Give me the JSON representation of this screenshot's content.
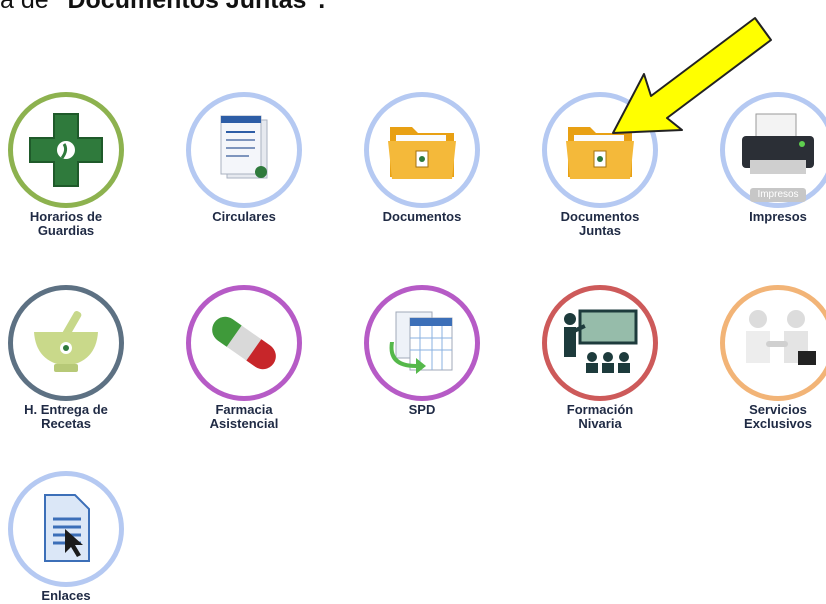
{
  "heading": {
    "prefix": "a de ",
    "bold": "\"Documentos Juntas\"."
  },
  "tiles": [
    {
      "line1": "Horarios de",
      "line2": "Guardias",
      "icon": "pharmacy-cross-icon"
    },
    {
      "line1": "Circulares",
      "line2": "",
      "icon": "document-stack-icon"
    },
    {
      "line1": "Documentos",
      "line2": "",
      "icon": "folder-icon"
    },
    {
      "line1": "Documentos",
      "line2": "Juntas",
      "icon": "folder-icon"
    },
    {
      "line1": "Impresos",
      "line2": "",
      "icon": "printer-icon",
      "badge": "Impresos"
    },
    {
      "line1": "H. Entrega de",
      "line2": "Recetas",
      "icon": "mortar-pestle-icon"
    },
    {
      "line1": "Farmacia",
      "line2": "Asistencial",
      "icon": "capsule-icon"
    },
    {
      "line1": "SPD",
      "line2": "",
      "icon": "spreadsheet-icon"
    },
    {
      "line1": "Formación",
      "line2": "Nivaria",
      "icon": "classroom-icon"
    },
    {
      "line1": "Servicios",
      "line2": "Exclusivos",
      "icon": "handshake-icon"
    },
    {
      "line1": "Enlaces",
      "line2": "",
      "icon": "document-link-icon"
    }
  ],
  "colors": {
    "ring_green": "#8db24f",
    "ring_blue": "#b5c9f2",
    "ring_slate": "#5d7183",
    "ring_purple": "#b65bc6",
    "ring_red": "#cd5a5a",
    "ring_orange": "#f2b477",
    "arrow": "#ffff00"
  }
}
